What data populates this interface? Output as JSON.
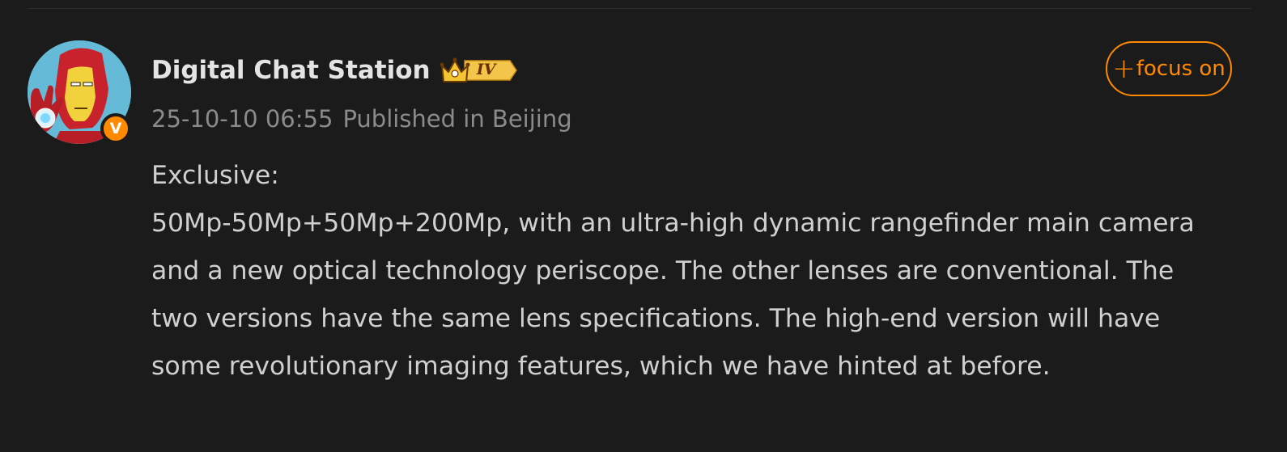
{
  "post": {
    "author": {
      "name": "Digital Chat Station",
      "level": "IV",
      "avatar_icon": "iron-man-avatar-icon",
      "verified_badge": "V",
      "verified_color": "#ff8a00"
    },
    "timestamp": "25-10-10 06:55",
    "location": "Published in Beijing",
    "follow_plus": "+",
    "follow_label": "focus on",
    "body": "Exclusive:\n50Mp-50Mp+50Mp+200Mp, with an ultra-high dynamic rangefinder main camera and a new optical technology periscope. The other lenses are conventional. The two versions have the same lens specifications. The high-end version will have some revolutionary imaging features, which we have hinted at before."
  },
  "colors": {
    "background": "#1b1b1b",
    "accent": "#ff8a00",
    "text": "#d0d0d0",
    "meta_text": "#8b8b8b"
  }
}
